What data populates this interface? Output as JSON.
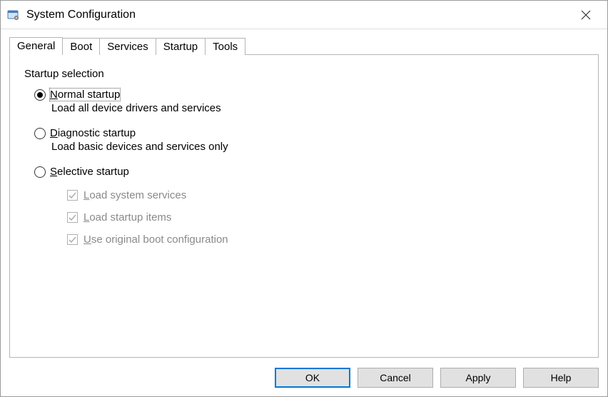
{
  "window": {
    "title": "System Configuration"
  },
  "tabs": [
    {
      "label": "General",
      "active": true
    },
    {
      "label": "Boot",
      "active": false
    },
    {
      "label": "Services",
      "active": false
    },
    {
      "label": "Startup",
      "active": false
    },
    {
      "label": "Tools",
      "active": false
    }
  ],
  "group": {
    "label": "Startup selection",
    "options": [
      {
        "id": "normal",
        "label_pre": "",
        "mnemonic": "N",
        "label_post": "ormal startup",
        "desc": "Load all device drivers and services",
        "selected": true
      },
      {
        "id": "diagnostic",
        "label_pre": "",
        "mnemonic": "D",
        "label_post": "iagnostic startup",
        "desc": "Load basic devices and services only",
        "selected": false
      },
      {
        "id": "selective",
        "label_pre": "",
        "mnemonic": "S",
        "label_post": "elective startup",
        "desc": "",
        "selected": false
      }
    ],
    "checks": [
      {
        "mnemonic": "L",
        "label_post": "oad system services",
        "checked": true,
        "enabled": false
      },
      {
        "mnemonic": "L",
        "label_post": "oad startup items",
        "checked": true,
        "enabled": false
      },
      {
        "mnemonic": "U",
        "label_post": "se original boot configuration",
        "checked": true,
        "enabled": false
      }
    ]
  },
  "buttons": {
    "ok": "OK",
    "cancel": "Cancel",
    "apply": "Apply",
    "help": "Help"
  }
}
